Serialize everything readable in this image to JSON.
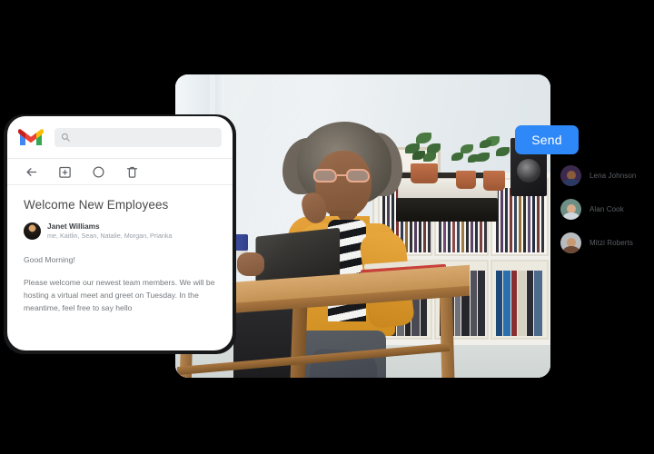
{
  "theme": {
    "background": "#000000",
    "accent_blue": "#2f88f7",
    "card_background": "#ffffff",
    "frame_dark": "#17181a",
    "text_muted": "#74787c"
  },
  "gmail_card": {
    "logo_icon": "gmail-m-logo-icon",
    "search": {
      "icon": "search-icon",
      "value": "",
      "placeholder": ""
    },
    "toolbar": [
      {
        "icon": "back-arrow-icon",
        "label": "Back"
      },
      {
        "icon": "archive-icon",
        "label": "Archive"
      },
      {
        "icon": "mark-unread-circle-icon",
        "label": "Mark unread"
      },
      {
        "icon": "trash-icon",
        "label": "Delete"
      }
    ],
    "email": {
      "subject": "Welcome New Employees",
      "sender_name": "Janet Williams",
      "recipients": "me, Kaitlin, Sean, Natalie, Morgan, Prianka",
      "avatar_icon": "sender-avatar",
      "body_paragraphs": [
        "Good Morning!",
        "Please welcome our newest team members. We will be hosting a virtual meet and greet on Tuesday. In the meantime, feel free to say hello"
      ]
    }
  },
  "photo": {
    "alt_description": "Woman in yellow cardigan and glasses sitting at a wooden table with a laptop and coffee cup in a record-filled room"
  },
  "send_button": {
    "label": "Send"
  },
  "contacts": {
    "items": [
      {
        "name": "Lena Johnson",
        "avatar_bg": "#3b2a4d",
        "skin": "#8a5c3c",
        "body": "#2b3a63"
      },
      {
        "name": "Alan Cook",
        "avatar_bg": "#6e8f86",
        "skin": "#d8ab8a",
        "body": "#cfd8dd"
      },
      {
        "name": "Mitzi Roberts",
        "avatar_bg": "#b9bcbe",
        "skin": "#c79a74",
        "body": "#6d4a35"
      }
    ]
  }
}
